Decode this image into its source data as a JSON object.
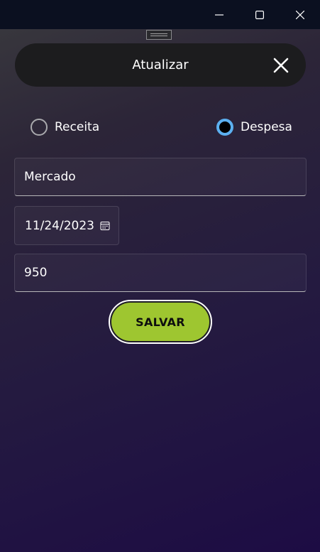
{
  "window": {
    "minimize_icon": "minimize-icon",
    "maximize_icon": "maximize-icon",
    "close_icon": "close-icon"
  },
  "header": {
    "title": "Atualizar",
    "close_icon": "close-icon"
  },
  "type_options": [
    {
      "label": "Receita",
      "selected": false
    },
    {
      "label": "Despesa",
      "selected": true
    }
  ],
  "form": {
    "description": "Mercado",
    "date": "11/24/2023",
    "date_icon": "calendar-icon",
    "amount": "950"
  },
  "save_button": {
    "label": "SALVAR",
    "color": "#9ec630"
  },
  "colors": {
    "accent_radio": "#5cb0f0",
    "titlebar": "#0b1020",
    "header_pill": "#1c1c1e"
  }
}
